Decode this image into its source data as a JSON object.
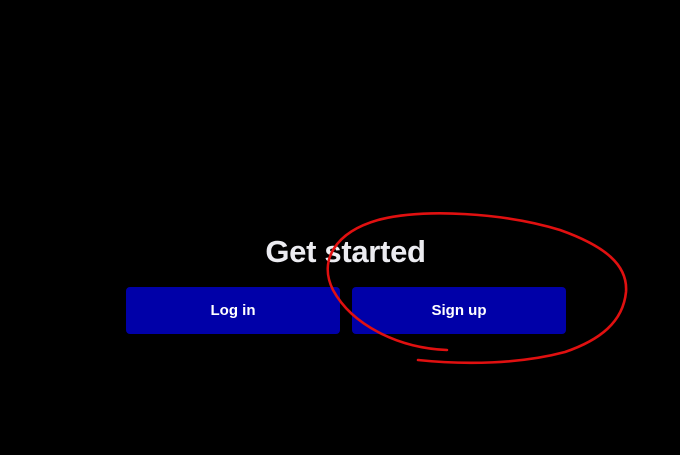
{
  "heading": {
    "title": "Get started"
  },
  "actions": {
    "login_label": "Log in",
    "signup_label": "Sign up"
  },
  "colors": {
    "background": "#000000",
    "button": "#0000a8",
    "heading_text": "#ececf1",
    "annotation": "#e01010"
  }
}
